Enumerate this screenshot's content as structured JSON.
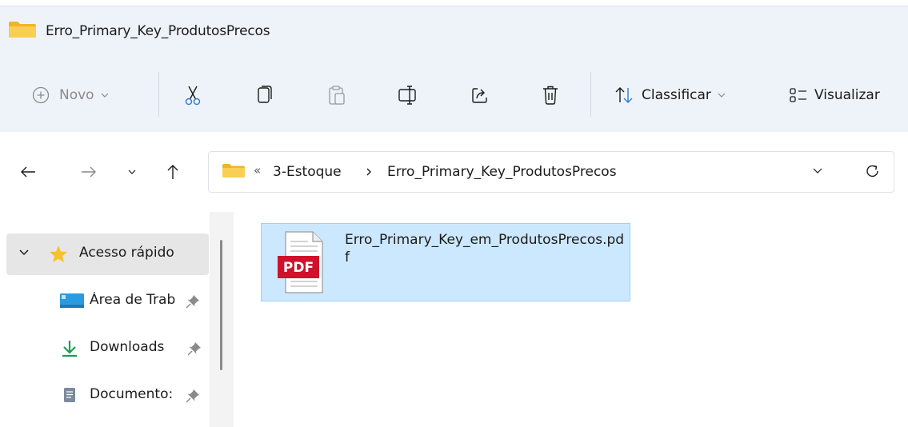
{
  "window": {
    "title": "Erro_Primary_Key_ProdutosPrecos"
  },
  "toolbar": {
    "new_label": "Novo",
    "sort_label": "Classificar",
    "view_label": "Visualizar",
    "icons": [
      "plus-circle-icon",
      "cut-icon",
      "copy-icon",
      "paste-icon",
      "rename-icon",
      "share-icon",
      "delete-icon",
      "sort-icon",
      "view-icon"
    ]
  },
  "address": {
    "overflow_indicator": "«",
    "crumbs": [
      "3-Estoque",
      "Erro_Primary_Key_ProdutosPrecos"
    ]
  },
  "sidebar": {
    "quick_access_label": "Acesso rápido",
    "items": [
      {
        "label": "Área de Trab",
        "icon": "desktop-icon",
        "pinned": true
      },
      {
        "label": "Downloads",
        "icon": "download-icon",
        "pinned": true
      },
      {
        "label": "Documento:",
        "icon": "document-icon",
        "pinned": true
      }
    ]
  },
  "files": [
    {
      "name": "Erro_Primary_Key_em_ProdutosPrecos.pdf",
      "type_badge": "PDF",
      "selected": true
    }
  ],
  "colors": {
    "toolbar_bg": "#eef3f9",
    "selection_bg": "#cce8ff",
    "selection_border": "#99d1ff",
    "folder_yellow": "#f5c342",
    "pdf_red": "#d0112b"
  }
}
